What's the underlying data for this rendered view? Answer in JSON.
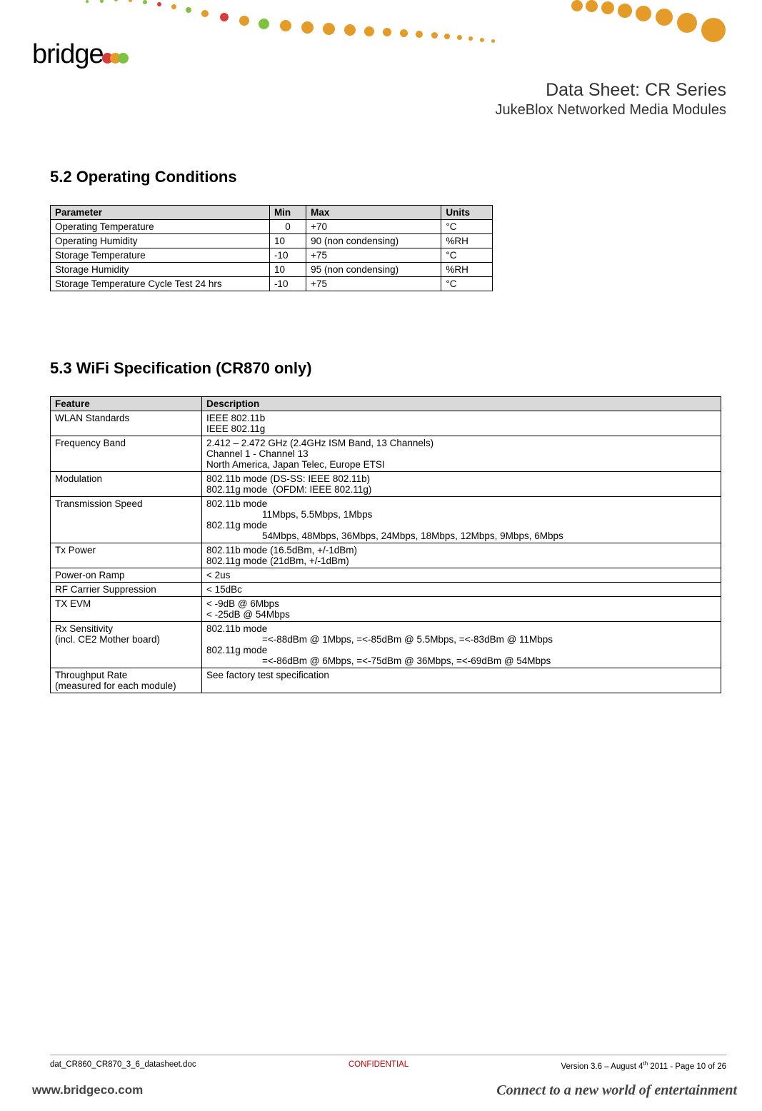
{
  "header": {
    "title_main": "Data Sheet: CR Series",
    "title_sub": "JukeBlox Networked Media Modules",
    "logo_text": "bridgeCo"
  },
  "sections": {
    "s52_title": "5.2 Operating Conditions",
    "s53_title": "5.3 WiFi Specification (CR870 only)"
  },
  "table_operating": {
    "headers": [
      "Parameter",
      "Min",
      "Max",
      "Units"
    ],
    "rows": [
      {
        "parameter": "Operating Temperature",
        "min": "  0",
        "max": "+70",
        "units": "°C"
      },
      {
        "parameter": "Operating Humidity",
        "min": " 10",
        "max": "90 (non condensing)",
        "units": "%RH"
      },
      {
        "parameter": "Storage Temperature",
        "min": "-10",
        "max": "+75",
        "units": "°C"
      },
      {
        "parameter": "Storage Humidity",
        "min": " 10",
        "max": "95 (non condensing)",
        "units": "%RH"
      },
      {
        "parameter": "Storage Temperature Cycle Test 24 hrs",
        "min": "-10",
        "max": "+75",
        "units": "°C"
      }
    ]
  },
  "table_wifi": {
    "headers": [
      "Feature",
      "Description"
    ],
    "rows": [
      {
        "feature": "WLAN Standards",
        "description": "IEEE 802.11b\nIEEE 802.11g"
      },
      {
        "feature": "Frequency Band",
        "description": "2.412 – 2.472 GHz (2.4GHz ISM Band, 13 Channels)\nChannel 1 - Channel 13\nNorth America, Japan Telec, Europe ETSI"
      },
      {
        "feature": "Modulation",
        "description": "802.11b mode (DS-SS: IEEE 802.11b)\n802.11g mode  (OFDM: IEEE 802.11g)"
      },
      {
        "feature": "Transmission Speed",
        "description_lines": [
          {
            "t": "802.11b mode"
          },
          {
            "t": "11Mbps, 5.5Mbps, 1Mbps",
            "indent": true
          },
          {
            "t": "802.11g mode"
          },
          {
            "t": "54Mbps, 48Mbps, 36Mbps, 24Mbps, 18Mbps, 12Mbps, 9Mbps, 6Mbps",
            "indent": true
          }
        ]
      },
      {
        "feature": "Tx Power",
        "description": "802.11b mode (16.5dBm, +/-1dBm)\n802.11g mode (21dBm, +/-1dBm)"
      },
      {
        "feature": "Power-on Ramp",
        "description": "< 2us"
      },
      {
        "feature": "RF Carrier Suppression",
        "description": "< 15dBc"
      },
      {
        "feature": "TX EVM",
        "description": "< -9dB @ 6Mbps\n< -25dB @ 54Mbps"
      },
      {
        "feature": "Rx Sensitivity\n(incl. CE2 Mother board)",
        "description_lines": [
          {
            "t": "802.11b mode"
          },
          {
            "t": "=<-88dBm @ 1Mbps, =<-85dBm @ 5.5Mbps, =<-83dBm @ 11Mbps",
            "indent": true
          },
          {
            "t": "802.11g mode"
          },
          {
            "t": "=<-86dBm @ 6Mbps, =<-75dBm @ 36Mbps, =<-69dBm @ 54Mbps",
            "indent": true
          }
        ]
      },
      {
        "feature": "Throughput Rate\n(measured for each module)",
        "description": "See factory test specification"
      }
    ]
  },
  "footer": {
    "doc": "dat_CR860_CR870_3_6_datasheet.doc",
    "confidential": "CONFIDENTIAL",
    "version_prefix": "Version 3.6 – August 4",
    "version_suffix": "th",
    "version_rest": " 2011 - Page 10 of 26",
    "url": "www.bridgeco.com",
    "tagline": "Connect to a new world of entertainment"
  }
}
